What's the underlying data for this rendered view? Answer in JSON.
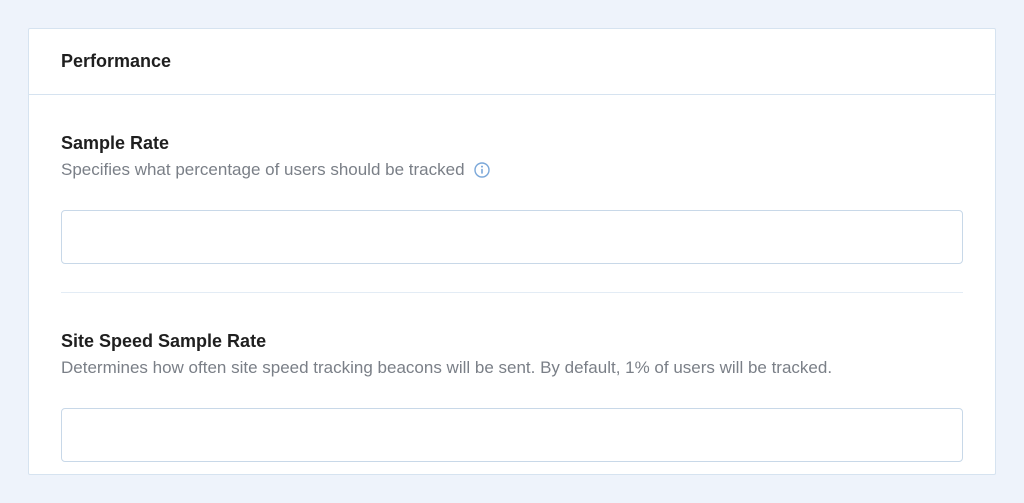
{
  "panel": {
    "title": "Performance",
    "fields": [
      {
        "label": "Sample Rate",
        "description": "Specifies what percentage of users should be tracked",
        "has_info": true,
        "value": ""
      },
      {
        "label": "Site Speed Sample Rate",
        "description": "Determines how often site speed tracking beacons will be sent. By default, 1% of users will be tracked.",
        "has_info": false,
        "value": ""
      }
    ]
  }
}
